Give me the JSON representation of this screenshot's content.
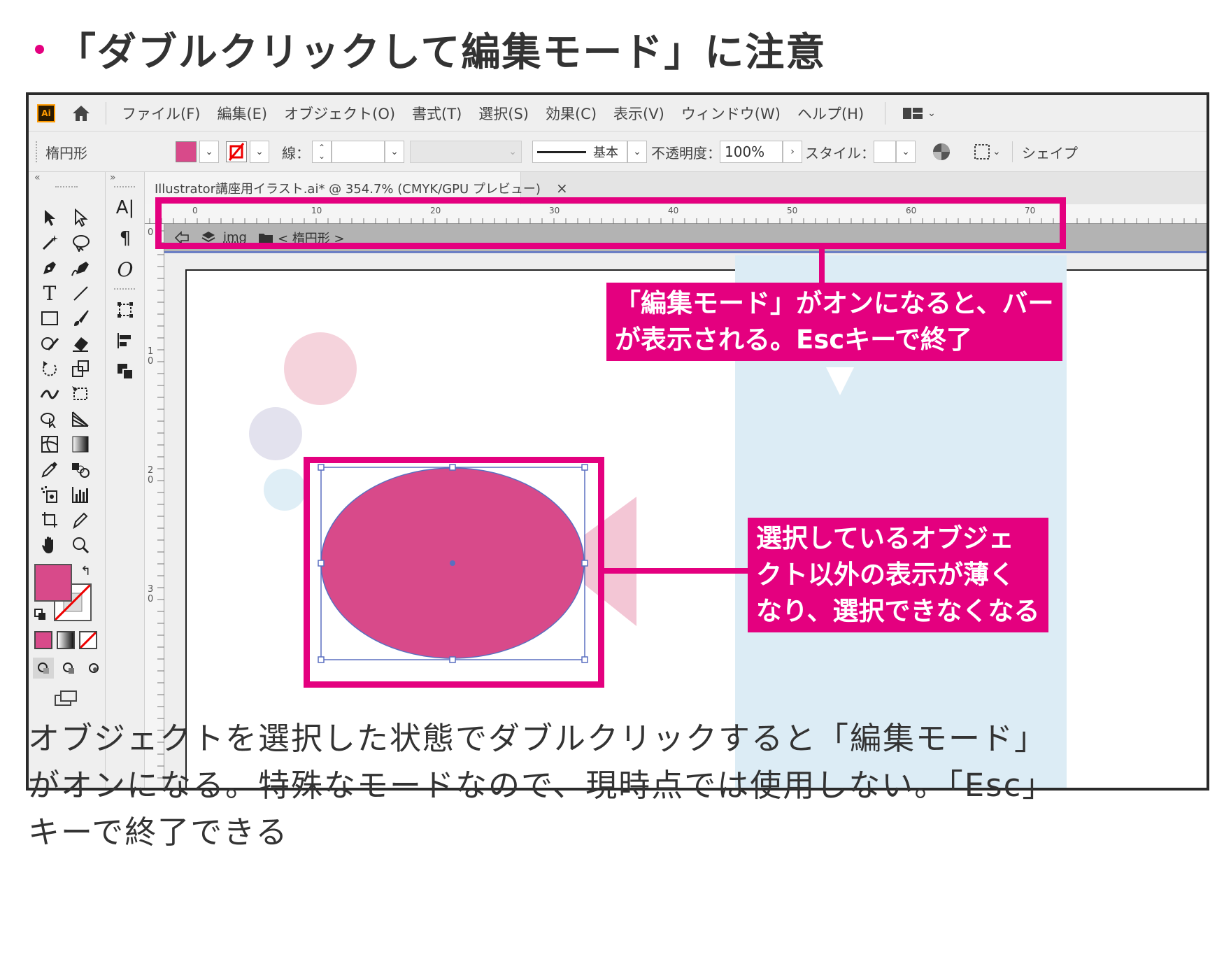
{
  "heading": {
    "text": "「ダブルクリックして編集モード」に注意"
  },
  "app": {
    "logo": "Ai",
    "menu": [
      "ファイル(F)",
      "編集(E)",
      "オブジェクト(O)",
      "書式(T)",
      "選択(S)",
      "効果(C)",
      "表示(V)",
      "ウィンドウ(W)",
      "ヘルプ(H)"
    ],
    "control_bar": {
      "object_type": "楕円形",
      "fill_color": "#d84a8a",
      "stroke_label": "線：",
      "stroke_style": "基本",
      "opacity_label": "不透明度：",
      "opacity_value": "100%",
      "style_label": "スタイル：",
      "shape_label": "シェイプ"
    },
    "document_tab": {
      "title": "Illustrator講座用イラスト.ai* @ 354.7% (CMYK/GPU プレビュー)",
      "close": "×"
    },
    "ruler": {
      "h_labels": [
        "0",
        "10",
        "20",
        "30",
        "40",
        "50",
        "60",
        "70"
      ],
      "v_labels": [
        "0",
        "10",
        "20",
        "30"
      ]
    },
    "isolation_bar": {
      "layer": "img",
      "object": "< 楕円形 >"
    },
    "fill_swatch": "#d84a8a"
  },
  "callouts": {
    "top": [
      "「編集モード」がオンになると、バー",
      "が表示される。Escキーで終了"
    ],
    "right": [
      "選択しているオブジェ",
      "クト以外の表示が薄く",
      "なり、選択できなくなる"
    ]
  },
  "paragraph": [
    "オブジェクトを選択した状態でダブルクリックすると「編集モード」",
    "がオンになる。特殊なモードなので、現時点では使用しない。「Esc」",
    "キーで終了できる"
  ],
  "colors": {
    "accent": "#e4007f",
    "ellipse": "#d84a8a",
    "selection": "#5a6fc0"
  }
}
